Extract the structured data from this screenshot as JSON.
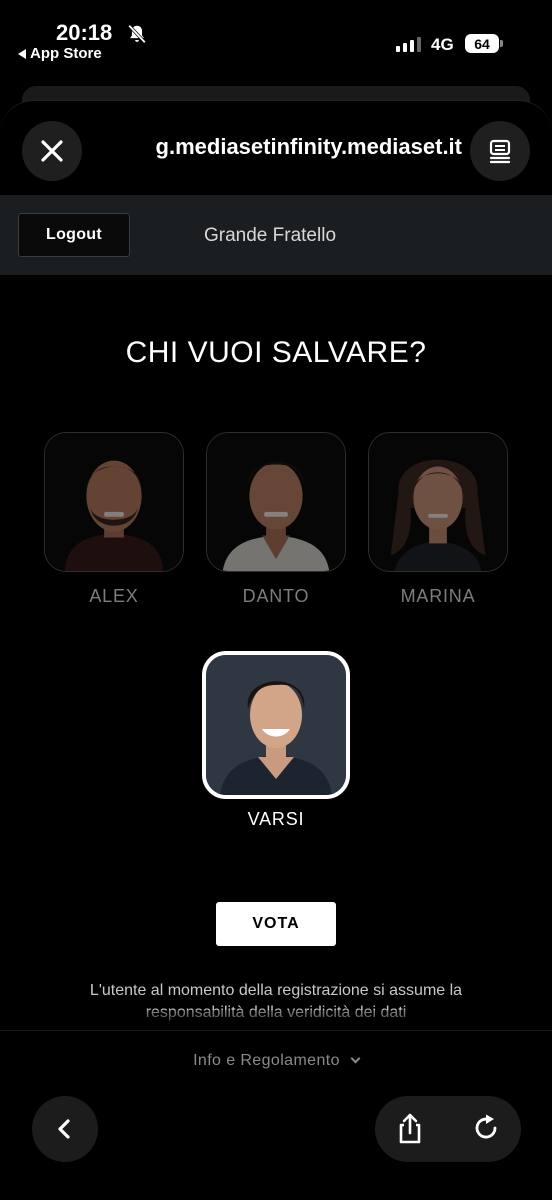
{
  "status_bar": {
    "time": "20:18",
    "back_label": "App Store",
    "network": "4G",
    "battery": "64"
  },
  "browser": {
    "url": "g.mediasetinfinity.mediaset.it"
  },
  "header": {
    "logout_label": "Logout",
    "title": "Grande Fratello"
  },
  "main": {
    "question": "CHI VUOI SALVARE?",
    "candidates": [
      {
        "name": "ALEX",
        "selected": false
      },
      {
        "name": "DANTO",
        "selected": false
      },
      {
        "name": "MARINA",
        "selected": false
      },
      {
        "name": "VARSI",
        "selected": true
      }
    ],
    "vote_label": "VOTA",
    "disclaimer": "L'utente al momento della registrazione si assume la responsabilità della veridicità dei dati"
  },
  "footer": {
    "info_label": "Info e Regolamento"
  },
  "colors": {
    "background": "#000000",
    "header_bg": "#1b1e20",
    "dimmed_name": "#7d7d7d",
    "selected_border": "#ffffff"
  }
}
